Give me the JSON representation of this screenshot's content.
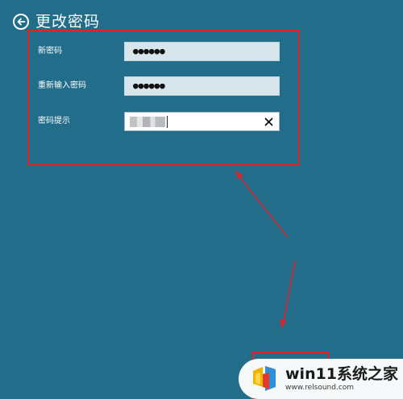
{
  "header": {
    "title": "更改密码",
    "back_icon": "back-arrow-circle-icon"
  },
  "form": {
    "fields": [
      {
        "label": "新密码",
        "value": "●●●●●●",
        "type": "password"
      },
      {
        "label": "重新输入密码",
        "value": "●●●●●●",
        "type": "password"
      },
      {
        "label": "密码提示",
        "value": "",
        "type": "text",
        "clear_icon": "close-icon"
      }
    ]
  },
  "watermark": {
    "title": "win11系统之家",
    "url": "www.relsound.com"
  },
  "colors": {
    "background": "#226d8a",
    "annotation": "#d9262b",
    "field_bg": "#d7e5ec"
  }
}
